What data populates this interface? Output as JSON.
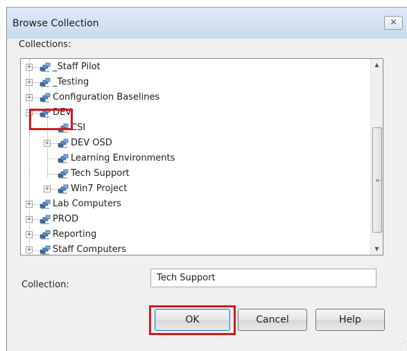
{
  "window": {
    "title": "Browse Collection",
    "close_glyph": "✕"
  },
  "labels": {
    "collections": "Collections:",
    "collection": "Collection:"
  },
  "collection_field": {
    "value": "Tech Support"
  },
  "tree": {
    "items": [
      {
        "label": "_Staff Pilot",
        "expander": "+"
      },
      {
        "label": "_Testing",
        "expander": "+"
      },
      {
        "label": "Configuration Baselines",
        "expander": "+"
      },
      {
        "label": "DEV",
        "expander": "−"
      },
      {
        "label": "CSI",
        "expander": ""
      },
      {
        "label": "DEV OSD",
        "expander": "+"
      },
      {
        "label": "Learning Environments",
        "expander": ""
      },
      {
        "label": "Tech Support",
        "expander": ""
      },
      {
        "label": "Win7 Project",
        "expander": "+"
      },
      {
        "label": "Lab Computers",
        "expander": "+"
      },
      {
        "label": "PROD",
        "expander": "+"
      },
      {
        "label": "Reporting",
        "expander": "+"
      },
      {
        "label": "Staff Computers",
        "expander": "+"
      }
    ],
    "icon": "collection-icon"
  },
  "scrollbar": {
    "up": "▲",
    "down": "▼",
    "grip": "≡"
  },
  "buttons": {
    "ok": "OK",
    "cancel": "Cancel",
    "help": "Help"
  },
  "colors": {
    "highlight_box": "#d4161c",
    "titlebar": "#c9dbf0"
  }
}
